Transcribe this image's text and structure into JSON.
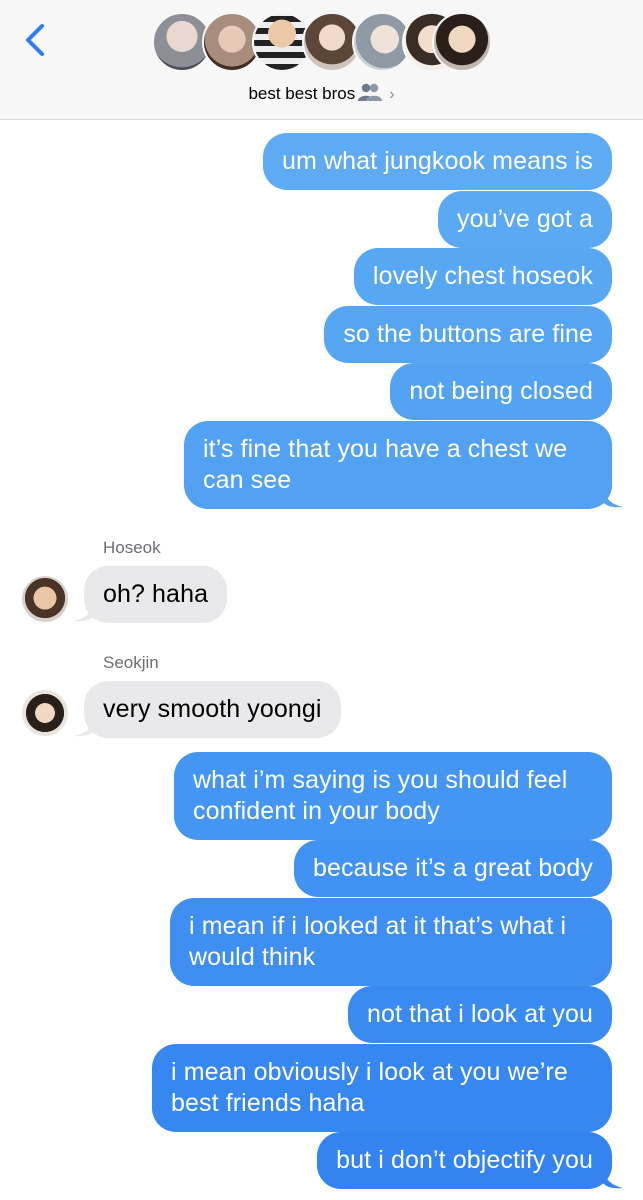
{
  "header": {
    "group_name": "best best bros",
    "back_icon": "chevron-left-icon",
    "group_emoji": "busts-in-silhouette-icon",
    "disclosure_icon": "chevron-right-icon",
    "member_avatars": [
      "avatar-1",
      "avatar-2",
      "avatar-3",
      "avatar-4",
      "avatar-5",
      "avatar-6",
      "avatar-7"
    ]
  },
  "colors": {
    "outgoing_top": "#5aa7f2",
    "outgoing_bottom": "#2f7ef0",
    "incoming": "#e9e9eb",
    "accent": "#2f7df6"
  },
  "messages": [
    {
      "dir": "out",
      "text": "um what jungkook means is"
    },
    {
      "dir": "out",
      "text": "you’ve got a"
    },
    {
      "dir": "out",
      "text": "lovely chest hoseok"
    },
    {
      "dir": "out",
      "text": "so the buttons are fine"
    },
    {
      "dir": "out",
      "text": "not being closed"
    },
    {
      "dir": "out",
      "text": "it’s fine that you have a chest we can see"
    },
    {
      "dir": "in",
      "sender": "Hoseok",
      "text": "oh? haha"
    },
    {
      "dir": "in",
      "sender": "Seokjin",
      "text": "very smooth yoongi"
    },
    {
      "dir": "out",
      "text": "what i’m saying is you should feel confident in your body"
    },
    {
      "dir": "out",
      "text": "because it’s a great body"
    },
    {
      "dir": "out",
      "text": "i mean if i looked at it that’s what i would think"
    },
    {
      "dir": "out",
      "text": "not that i look at you"
    },
    {
      "dir": "out",
      "text": "i mean obviously i look at you we’re best friends haha"
    },
    {
      "dir": "out",
      "text": "but i don’t objectify you"
    }
  ]
}
